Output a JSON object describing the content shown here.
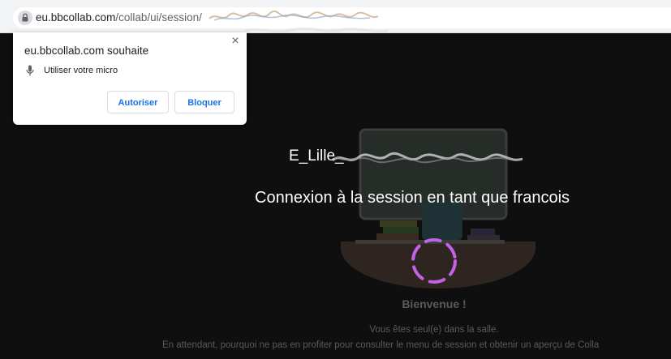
{
  "browser": {
    "url_host": "eu.bbcollab.com",
    "url_path": "/collab/ui/session/"
  },
  "permission_popup": {
    "title": "eu.bbcollab.com souhaite",
    "permission": "Utiliser votre micro",
    "allow_label": "Autoriser",
    "block_label": "Bloquer",
    "close_label": "×"
  },
  "session": {
    "name_prefix": "E_Lille_",
    "connecting_text": "Connexion à la session en tant que francois",
    "welcome_title": "Bienvenue !",
    "alone_text": "Vous êtes seul(e) dans la salle.",
    "meanwhile_text": "En attendant, pourquoi ne pas en profiter pour consulter le menu de session et obtenir un aperçu de Colla"
  },
  "colors": {
    "background": "#0f0f0f",
    "link_blue": "#1a73e8",
    "spinner": "#c462e6",
    "muted_text": "#5a5a5a"
  }
}
